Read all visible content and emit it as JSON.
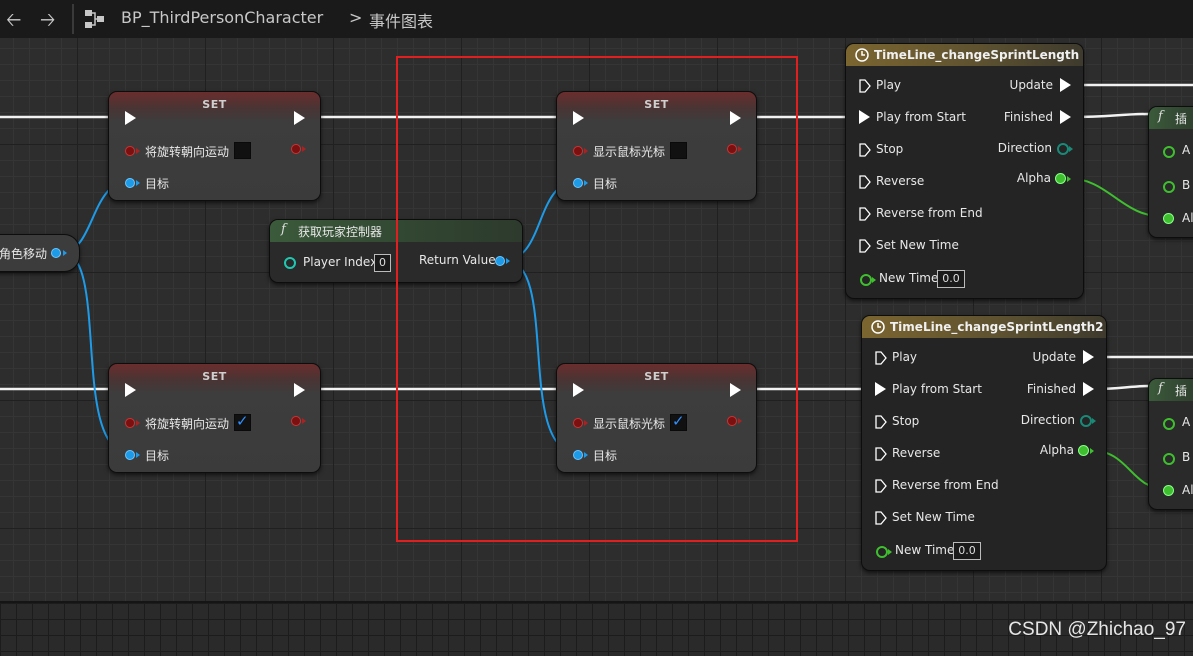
{
  "toolbar": {
    "back_icon": "arrow-left-icon",
    "forward_icon": "arrow-right-icon",
    "blueprint_icon": "blueprint-graph-icon",
    "breadcrumb_blueprint": "BP_ThirdPersonCharacter",
    "breadcrumb_separator": ">",
    "breadcrumb_graph": "事件图表"
  },
  "graph": {
    "var_node_left": "角色移动",
    "set_nodes": [
      {
        "title": "SET",
        "bool_label": "将旋转朝向运动",
        "checked": false,
        "target_label": "目标"
      },
      {
        "title": "SET",
        "bool_label": "将旋转朝向运动",
        "checked": true,
        "target_label": "目标"
      },
      {
        "title": "SET",
        "bool_label": "显示鼠标光标",
        "checked": false,
        "target_label": "目标"
      },
      {
        "title": "SET",
        "bool_label": "显示鼠标光标",
        "checked": true,
        "target_label": "目标"
      }
    ],
    "func_node": {
      "title": "获取玩家控制器",
      "input_label": "Player Index",
      "input_value": "0",
      "output_label": "Return Value"
    },
    "timelines": [
      {
        "title": "TimeLine_changeSprintLength",
        "inputs": [
          "Play",
          "Play from Start",
          "Stop",
          "Reverse",
          "Reverse from End",
          "Set New Time"
        ],
        "new_time_label": "New Time",
        "new_time_value": "0.0",
        "outputs": [
          "Update",
          "Finished",
          "Direction",
          "Alpha"
        ]
      },
      {
        "title": "TimeLine_changeSprintLength2",
        "inputs": [
          "Play",
          "Play from Start",
          "Stop",
          "Reverse",
          "Reverse from End",
          "Set New Time"
        ],
        "new_time_label": "New Time",
        "new_time_value": "0.0",
        "outputs": [
          "Update",
          "Finished",
          "Direction",
          "Alpha"
        ]
      }
    ],
    "lerp_nodes": [
      {
        "title": "插",
        "pins": [
          "A",
          "B",
          "Al"
        ]
      },
      {
        "title": "插",
        "pins": [
          "A",
          "B",
          "Al"
        ]
      }
    ]
  },
  "watermark": "CSDN @Zhichao_97",
  "colors": {
    "exec_wire": "#ffffff",
    "object_wire": "#1e9be8",
    "float_wire": "#3fbf2f",
    "highlight_box": "#e02020"
  }
}
